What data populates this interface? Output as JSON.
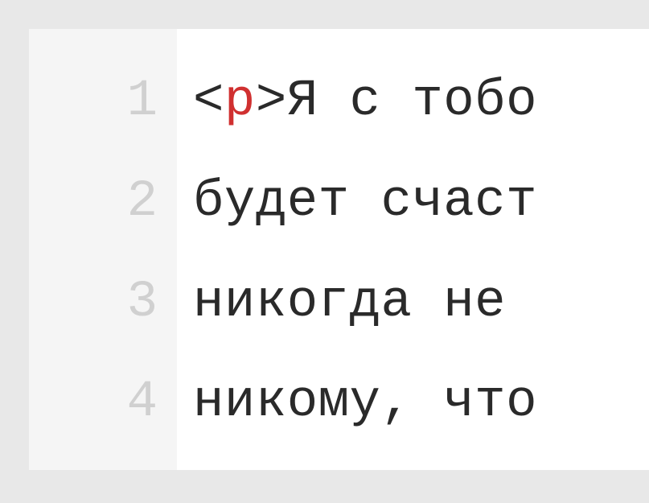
{
  "editor": {
    "lines": [
      {
        "number": "1",
        "segments": [
          {
            "type": "bracket",
            "text": "<"
          },
          {
            "type": "tag",
            "text": "p"
          },
          {
            "type": "bracket",
            "text": ">"
          },
          {
            "type": "content",
            "text": "Я с тобо"
          }
        ]
      },
      {
        "number": "2",
        "segments": [
          {
            "type": "content",
            "text": "будет счаст"
          }
        ]
      },
      {
        "number": "3",
        "segments": [
          {
            "type": "content",
            "text": "никогда не "
          }
        ]
      },
      {
        "number": "4",
        "segments": [
          {
            "type": "content",
            "text": "никому, что"
          }
        ]
      }
    ]
  }
}
